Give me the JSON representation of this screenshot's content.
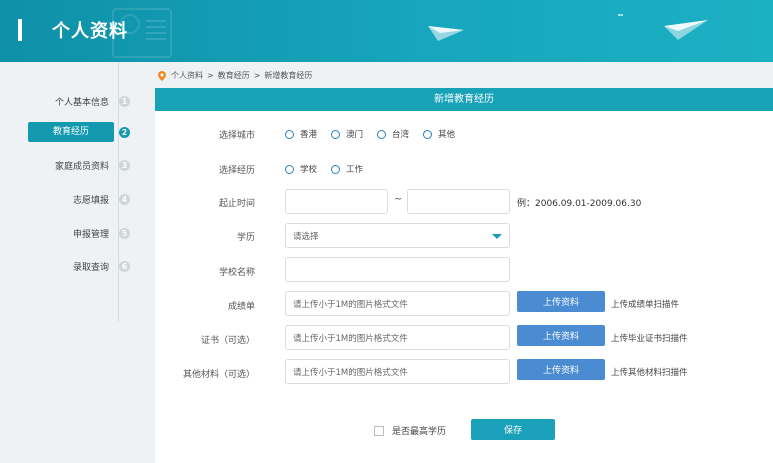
{
  "header": {
    "title": "个人资料"
  },
  "breadcrumb": {
    "items": [
      "个人资料",
      "教育经历",
      "新增教育经历"
    ],
    "separator": ">"
  },
  "sidebar": {
    "items": [
      {
        "label": "个人基本信息",
        "num": "1",
        "active": false
      },
      {
        "label": "教育经历",
        "num": "2",
        "active": true
      },
      {
        "label": "家庭成员资料",
        "num": "3",
        "active": false
      },
      {
        "label": "志愿填报",
        "num": "4",
        "active": false
      },
      {
        "label": "申报管理",
        "num": "5",
        "active": false
      },
      {
        "label": "录取查询",
        "num": "6",
        "active": false
      }
    ]
  },
  "form": {
    "heading": "新增教育经历",
    "city": {
      "label": "选择城市",
      "options": [
        "香港",
        "澳门",
        "台湾",
        "其他"
      ]
    },
    "experience": {
      "label": "选择经历",
      "options": [
        "学校",
        "工作"
      ]
    },
    "period": {
      "label": "起止时间",
      "separator": "~",
      "example": "例：2006.09.01-2009.06.30"
    },
    "degree": {
      "label": "学历",
      "placeholder": "请选择"
    },
    "school": {
      "label": "学校名称"
    },
    "transcript": {
      "label": "成绩单",
      "placeholder": "请上传小于1M的图片格式文件",
      "button": "上传资料",
      "hint": "上传成绩单扫描件"
    },
    "certificate": {
      "label": "证书（可选）",
      "placeholder": "请上传小于1M的图片格式文件",
      "button": "上传资料",
      "hint": "上传毕业证书扫描件"
    },
    "other": {
      "label": "其他材料（可选）",
      "placeholder": "请上传小于1M的图片格式文件",
      "button": "上传资料",
      "hint": "上传其他材料扫描件"
    },
    "highest": {
      "label": "是否最高学历"
    },
    "save": "保存"
  },
  "colors": {
    "primary": "#17a2b8",
    "upload": "#4a8bd2",
    "radio": "#2a7fc4"
  }
}
